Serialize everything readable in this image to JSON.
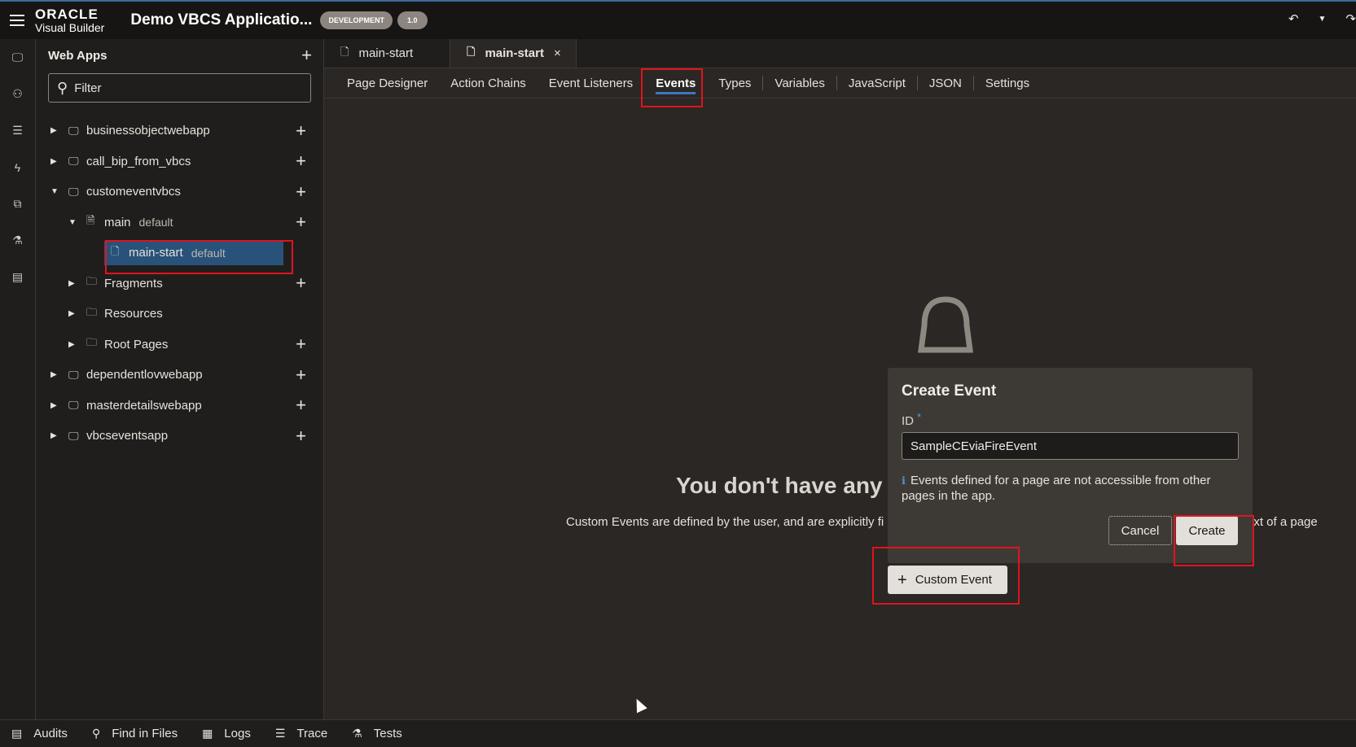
{
  "header": {
    "brand_line1": "ORACLE",
    "brand_line2": "Visual Builder",
    "app_title": "Demo VBCS Applicatio...",
    "env_badge": "DEVELOPMENT",
    "version_badge": "1.0",
    "undo_icon": "undo-icon",
    "dropdown_icon": "chevron-down-icon"
  },
  "rail": {
    "icons": [
      "web-app-icon",
      "service-connection-icon",
      "business-objects-icon",
      "processes-icon",
      "components-icon",
      "layouts-icon",
      "source-icon"
    ]
  },
  "sidebar": {
    "title": "Web Apps",
    "filter_placeholder": "Filter",
    "tree": [
      {
        "label": "businessobjectwebapp",
        "tag": ""
      },
      {
        "label": "call_bip_from_vbcs",
        "tag": ""
      },
      {
        "label": "customeventvbcs",
        "tag": ""
      },
      {
        "label": "main",
        "tag": "default"
      },
      {
        "label": "main-start",
        "tag": "default"
      },
      {
        "label": "Fragments",
        "tag": ""
      },
      {
        "label": "Resources",
        "tag": ""
      },
      {
        "label": "Root Pages",
        "tag": ""
      },
      {
        "label": "dependentlovwebapp",
        "tag": ""
      },
      {
        "label": "masterdetailswebapp",
        "tag": ""
      },
      {
        "label": "vbcseventsapp",
        "tag": ""
      }
    ]
  },
  "editor_tabs": [
    {
      "label": "main-start"
    },
    {
      "label": "main-start",
      "close": "×"
    }
  ],
  "subtabs": [
    "Page Designer",
    "Action Chains",
    "Event Listeners",
    "Events",
    "Types",
    "Variables",
    "JavaScript",
    "JSON",
    "Settings"
  ],
  "empty_state": {
    "title": "You don't have any",
    "text_left": "Custom Events are defined by the user, and are explicitly fi",
    "text_right": "ext of a page",
    "add_button": "Custom Event"
  },
  "dialog": {
    "title": "Create Event",
    "id_label": "ID",
    "required_mark": "*",
    "id_value": "SampleCEviaFireEvent",
    "note": "Events defined for a page are not accessible from other pages in the app.",
    "cancel": "Cancel",
    "create": "Create"
  },
  "bottombar": [
    "Audits",
    "Find in Files",
    "Logs",
    "Trace",
    "Tests"
  ],
  "colors": {
    "accent": "#3b78c2",
    "highlight": "#e0141e",
    "selected_row": "#28527a"
  }
}
